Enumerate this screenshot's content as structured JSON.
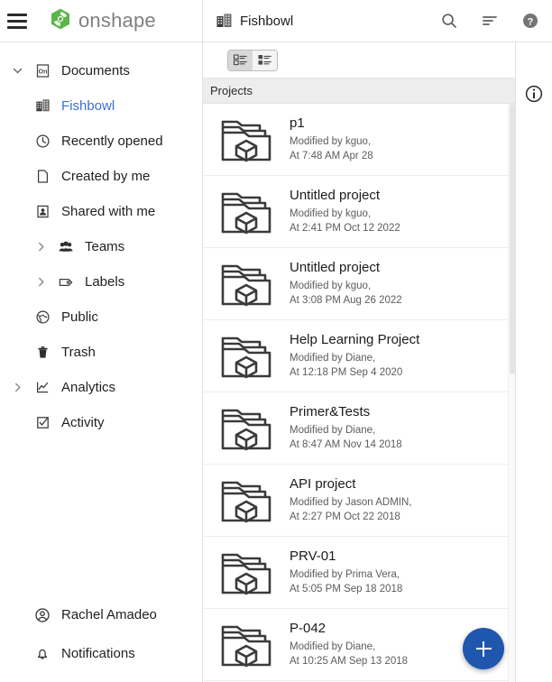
{
  "topbar": {
    "menu_icon": "hamburger-icon",
    "brand": "onshape",
    "brand_color": "#5ab648",
    "workspace_icon": "building-icon",
    "workspace_title": "Fishbowl",
    "actions": [
      {
        "name": "search-icon",
        "label": "Search"
      },
      {
        "name": "sort-icon",
        "label": "Sort"
      },
      {
        "name": "help-icon",
        "label": "Help"
      }
    ]
  },
  "sidebar": {
    "items": [
      {
        "label": "Documents",
        "icon": "onshape-documents-icon",
        "level": 0,
        "chevron": "down",
        "active": false
      },
      {
        "label": "Fishbowl",
        "icon": "building-icon",
        "level": 1,
        "chevron": "none",
        "active": true
      },
      {
        "label": "Recently opened",
        "icon": "clock-icon",
        "level": 1,
        "chevron": "none",
        "active": false
      },
      {
        "label": "Created by me",
        "icon": "document-icon",
        "level": 1,
        "chevron": "none",
        "active": false
      },
      {
        "label": "Shared with me",
        "icon": "shared-user-icon",
        "level": 1,
        "chevron": "none",
        "active": false
      },
      {
        "label": "Teams",
        "icon": "people-icon",
        "level": 1,
        "chevron": "right",
        "active": false
      },
      {
        "label": "Labels",
        "icon": "tag-icon",
        "level": 1,
        "chevron": "right",
        "active": false
      },
      {
        "label": "Public",
        "icon": "globe-icon",
        "level": 1,
        "chevron": "none",
        "active": false
      },
      {
        "label": "Trash",
        "icon": "trash-icon",
        "level": 1,
        "chevron": "none",
        "active": false
      },
      {
        "label": "Analytics",
        "icon": "analytics-icon",
        "level": 0,
        "chevron": "right",
        "active": false
      },
      {
        "label": "Activity",
        "icon": "checkbox-icon",
        "level": 0,
        "chevron": "none",
        "active": false
      }
    ],
    "bottom_items": [
      {
        "label": "Rachel Amadeo",
        "icon": "account-icon"
      },
      {
        "label": "Notifications",
        "icon": "bell-icon"
      }
    ]
  },
  "main": {
    "view_toggle": [
      {
        "name": "list-view-compact-icon",
        "selected": false
      },
      {
        "name": "list-view-detail-icon",
        "selected": true
      }
    ],
    "section_title": "Projects",
    "accent_color": "#1f56ae",
    "active_color": "#3b6fd4",
    "projects": [
      {
        "name": "p1",
        "modified_by": "Modified by kguo,",
        "modified_at": "At 7:48 AM Apr 28"
      },
      {
        "name": "Untitled project",
        "modified_by": "Modified by kguo,",
        "modified_at": "At 2:41 PM Oct 12 2022"
      },
      {
        "name": "Untitled project",
        "modified_by": "Modified by kguo,",
        "modified_at": "At 3:08 PM Aug 26 2022"
      },
      {
        "name": "Help Learning Project",
        "modified_by": "Modified by Diane,",
        "modified_at": "At 12:18 PM Sep 4 2020"
      },
      {
        "name": "Primer&Tests",
        "modified_by": "Modified by Diane,",
        "modified_at": "At 8:47 AM Nov 14 2018"
      },
      {
        "name": "API project",
        "modified_by": "Modified by Jason ADMIN,",
        "modified_at": "At 2:27 PM Oct 22 2018"
      },
      {
        "name": "PRV-01",
        "modified_by": "Modified by Prima Vera,",
        "modified_at": "At 5:05 PM Sep 18 2018"
      },
      {
        "name": "P-042",
        "modified_by": "Modified by Diane,",
        "modified_at": "At 10:25 AM Sep 13 2018"
      }
    ],
    "fab": {
      "name": "create-button",
      "icon": "plus-icon"
    }
  },
  "rail": {
    "items": [
      {
        "name": "info-icon",
        "label": "Info"
      }
    ]
  }
}
